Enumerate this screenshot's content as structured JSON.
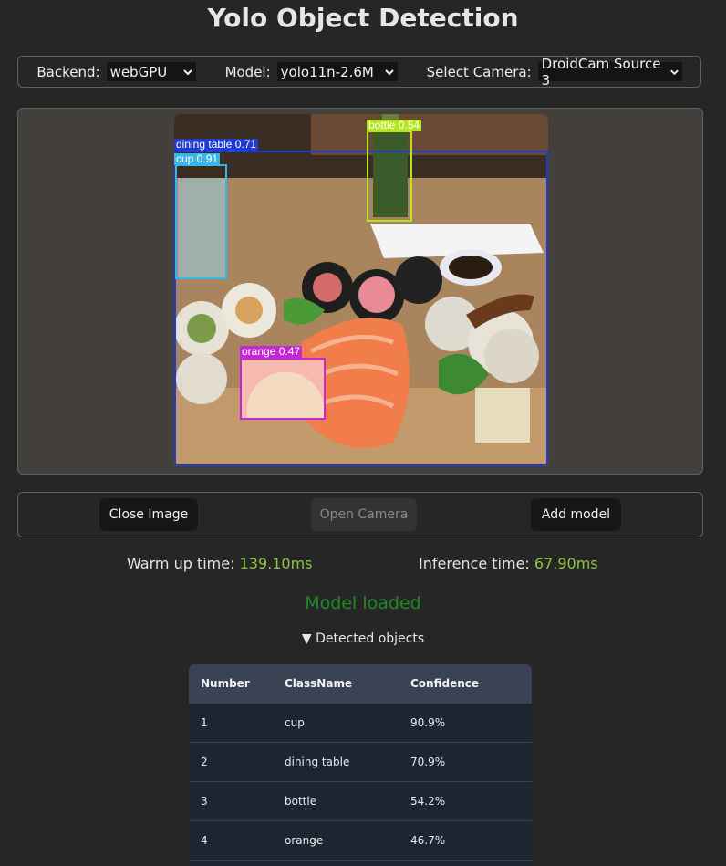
{
  "header": {
    "title": "Yolo Object Detection"
  },
  "controls": {
    "backend": {
      "label": "Backend:",
      "value": "webGPU"
    },
    "model": {
      "label": "Model:",
      "value": "yolo11n-2.6M"
    },
    "camera": {
      "label": "Select Camera:",
      "value": "DroidCam Source 3"
    }
  },
  "detections_overlay": [
    {
      "label": "dining table 0.71",
      "color": "#1f3bd1"
    },
    {
      "label": "cup 0.91",
      "color": "#38b6e8"
    },
    {
      "label": "bottle 0.54",
      "color": "#b5e61d"
    },
    {
      "label": "orange 0.47",
      "color": "#c526d6"
    }
  ],
  "actions": {
    "close_image": "Close Image",
    "open_camera": "Open Camera",
    "add_model": "Add model"
  },
  "timing": {
    "warmup_label": "Warm up time:",
    "warmup_value": "139.10ms",
    "inference_label": "Inference time:",
    "inference_value": "67.90ms"
  },
  "status": "Model loaded",
  "detected": {
    "summary": "Detected objects",
    "headers": [
      "Number",
      "ClassName",
      "Confidence"
    ],
    "rows": [
      [
        "1",
        "cup",
        "90.9%"
      ],
      [
        "2",
        "dining table",
        "70.9%"
      ],
      [
        "3",
        "bottle",
        "54.2%"
      ],
      [
        "4",
        "orange",
        "46.7%"
      ]
    ]
  }
}
